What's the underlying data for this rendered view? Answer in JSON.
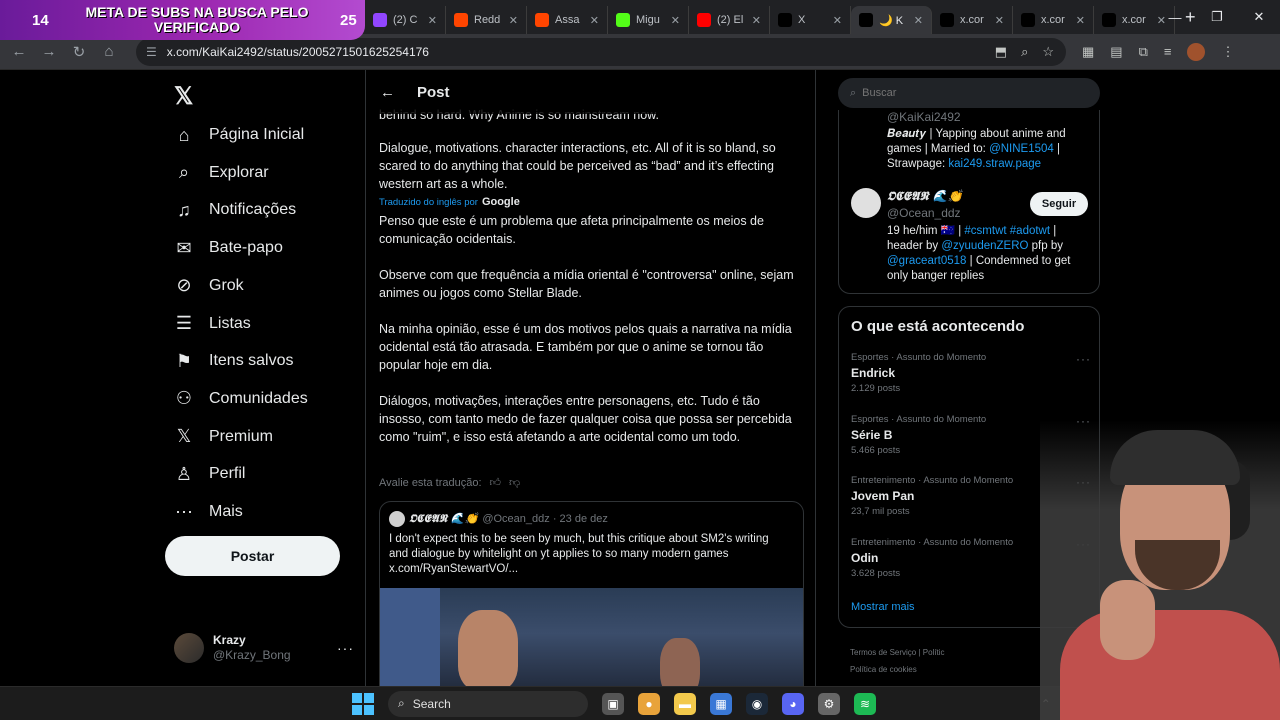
{
  "browser": {
    "tabs": [
      {
        "title": "(2) C",
        "icon": "twitch-icon",
        "color": "#9146ff",
        "active": false
      },
      {
        "title": "Redd",
        "icon": "reddit-icon",
        "color": "#ff4500",
        "active": false
      },
      {
        "title": "Assa",
        "icon": "reddit-icon",
        "color": "#ff4500",
        "active": false
      },
      {
        "title": "Migu",
        "icon": "kick-icon",
        "color": "#53fc18",
        "active": false
      },
      {
        "title": "(2) El",
        "icon": "youtube-icon",
        "color": "#ff0000",
        "active": false
      },
      {
        "title": "X",
        "icon": "x-icon",
        "color": "#000000",
        "active": false
      },
      {
        "title": "🌙 K",
        "icon": "x-icon",
        "color": "#000000",
        "active": true
      },
      {
        "title": "x.cor",
        "icon": "x-icon",
        "color": "#000000",
        "active": false
      },
      {
        "title": "x.cor",
        "icon": "x-icon",
        "color": "#000000",
        "active": false
      },
      {
        "title": "x.cor",
        "icon": "x-icon",
        "color": "#000000",
        "active": false
      }
    ],
    "url": "x.com/KaiKai2492/status/2005271501625254176"
  },
  "overlay": {
    "count_left": "14",
    "text": "META DE SUBS NA BUSCA PELO VERIFICADO",
    "count_right": "25"
  },
  "nav": {
    "items": [
      {
        "label": "Página Inicial",
        "icon": "home-icon"
      },
      {
        "label": "Explorar",
        "icon": "search-icon"
      },
      {
        "label": "Notificações",
        "icon": "bell-icon"
      },
      {
        "label": "Bate-papo",
        "icon": "mail-icon"
      },
      {
        "label": "Grok",
        "icon": "grok-icon"
      },
      {
        "label": "Listas",
        "icon": "list-icon"
      },
      {
        "label": "Itens salvos",
        "icon": "bookmark-icon"
      },
      {
        "label": "Comunidades",
        "icon": "communities-icon"
      },
      {
        "label": "Premium",
        "icon": "x-icon"
      },
      {
        "label": "Perfil",
        "icon": "user-icon"
      },
      {
        "label": "Mais",
        "icon": "more-circle-icon"
      }
    ],
    "post_label": "Postar",
    "account": {
      "name": "Krazy",
      "handle": "@Krazy_Bong"
    }
  },
  "post": {
    "header": "Post",
    "text_top": "behind so hard. Why Anime is so mainstream now.",
    "text_en": "Dialogue, motivations. character interactions, etc. All of it is so bland, so scared to do anything that could be perceived as “bad” and it’s effecting western art as a whole.",
    "translated_label": "Traduzido do inglês por",
    "translated_brand": "Google",
    "pt_paragraphs": [
      "Penso que este é um problema que afeta principalmente os meios de comunicação ocidentais.",
      "Observe com que frequência a mídia oriental é \"controversa\" online, sejam animes ou jogos como Stellar Blade.",
      "Na minha opinião, esse é um dos motivos pelos quais a narrativa na mídia ocidental está tão atrasada. E também por que o anime se tornou tão popular hoje em dia.",
      "Diálogos, motivações, interações entre personagens, etc. Tudo é tão insosso, com tanto medo de fazer qualquer coisa que possa ser percebida como \"ruim\", e isso está afetando a arte ocidental como um todo."
    ],
    "rate_label": "Avalie esta tradução:",
    "quote": {
      "name": "𝕺𝕮𝕰𝕬𝕹 🌊👏",
      "handle": "@Ocean_ddz · 23 de dez",
      "text": "I don't expect this to be seen by much, but this critique about SM2's writing and dialogue by whitelight on yt applies to so many modern games x.com/RyanStewartVO/..."
    }
  },
  "sidebar": {
    "search_placeholder": "Buscar",
    "who": {
      "handle1": "@KaiKai2492",
      "bio1_prefix": "𝑩𝒆𝒂𝒖𝒕𝒚 | Yapping about anime and games | Married to: ",
      "bio1_link1": "@NINE1504",
      "bio1_mid": " | Strawpage: ",
      "bio1_link2": "kai249.straw.page",
      "name2": "𝕺𝕮𝕰𝕬𝕹 🌊👏",
      "handle2": "@Ocean_ddz",
      "follow_label": "Seguir",
      "bio2_a": "19 he/him 🇦🇺 | ",
      "bio2_tags": "#csmtwt #adotwt",
      "bio2_b": " | header by ",
      "bio2_link1": "@zyuudenZERO",
      "bio2_c": " pfp by ",
      "bio2_link2": "@graceart0518",
      "bio2_d": " | Condemned to get only banger replies"
    },
    "trends_title": "O que está acontecendo",
    "trends": [
      {
        "category": "Esportes · Assunto do Momento",
        "name": "Endrick",
        "count": "2.129 posts"
      },
      {
        "category": "Esportes · Assunto do Momento",
        "name": "Série B",
        "count": "5.466 posts"
      },
      {
        "category": "Entretenimento · Assunto do Momento",
        "name": "Jovem Pan",
        "count": "23,7 mil posts"
      },
      {
        "category": "Entretenimento · Assunto do Momento",
        "name": "Odin",
        "count": "3.628 posts"
      }
    ],
    "show_more": "Mostrar mais",
    "footer": [
      "Termos de Serviço  |  Polític",
      "Política de cookies"
    ]
  },
  "taskbar": {
    "search_label": "Search"
  }
}
